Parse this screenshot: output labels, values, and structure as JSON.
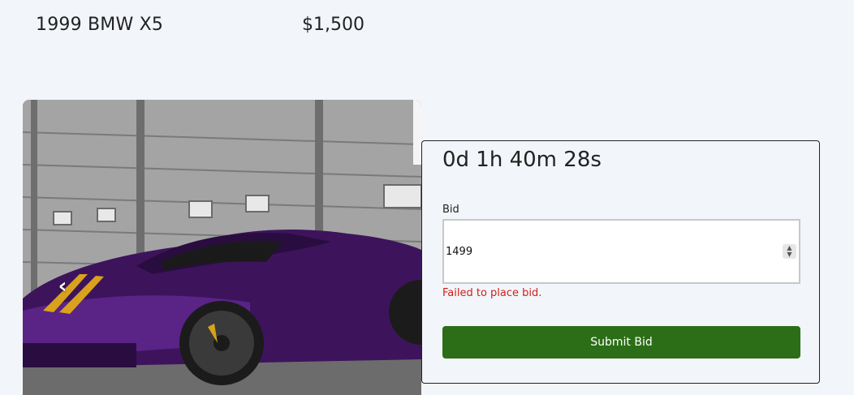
{
  "listing": {
    "title": "1999 BMW X5",
    "price": "$1,500"
  },
  "carousel": {
    "prev_label": "‹",
    "next_label": "›"
  },
  "bid_panel": {
    "timer": "0d 1h 40m 28s",
    "bid_label": "Bid",
    "bid_value": "1499",
    "error_message": "Failed to place bid.",
    "submit_label": "Submit Bid"
  },
  "colors": {
    "background": "#f2f5fa",
    "submit_button": "#2b6e17",
    "error_text": "#d0201a",
    "car_body": "#4a1a6e",
    "car_stripes": "#d9a21c"
  }
}
